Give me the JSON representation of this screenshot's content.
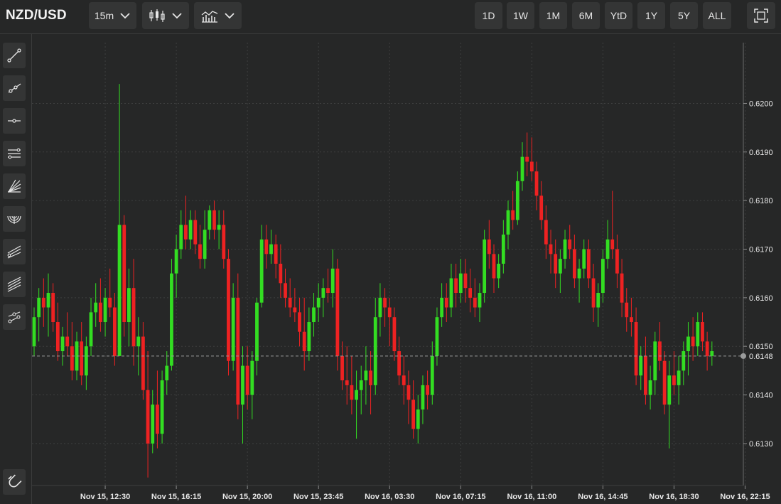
{
  "header": {
    "symbol": "NZD/USD",
    "interval": "15m",
    "chart_type_icon": "candlestick-icon",
    "indicators_icon": "indicators-icon",
    "ranges": [
      "1D",
      "1W",
      "1M",
      "6M",
      "YtD",
      "1Y",
      "5Y",
      "ALL"
    ],
    "fullscreen_icon": "fullscreen-icon"
  },
  "toolbar": {
    "tools": [
      "trend-line-icon",
      "ray-icon",
      "horizontal-line-icon",
      "parallel-channel-icon",
      "fib-fan-icon",
      "fib-arc-icon",
      "pitchfork-icon",
      "regression-channel-icon",
      "path-icon"
    ],
    "bottom_tool": "magnet-icon"
  },
  "colors": {
    "background": "#262727",
    "panel": "#343535",
    "up": "#33dd22",
    "down": "#ee2222",
    "grid": "#3e3f3f",
    "text": "#e8e8e8"
  },
  "chart_data": {
    "type": "candlestick",
    "x_tick_labels": [
      "Nov 15, 12:30",
      "Nov 15, 16:15",
      "Nov 15, 20:00",
      "Nov 15, 23:45",
      "Nov 16, 03:30",
      "Nov 16, 07:15",
      "Nov 16, 11:00",
      "Nov 16, 14:45",
      "Nov 16, 18:30",
      "Nov 16, 22:15"
    ],
    "y_ticks": [
      0.613,
      0.614,
      0.615,
      0.616,
      0.617,
      0.618,
      0.619,
      0.62
    ],
    "y_tick_labels": [
      "0.6130",
      "0.6140",
      "0.6150",
      "0.6160",
      "0.6170",
      "0.6180",
      "0.6190",
      "0.6200"
    ],
    "ylim": [
      0.61215,
      0.62125
    ],
    "bars_per_tick": 15,
    "first_tick_bar": 15,
    "last_price": 0.6148,
    "last_price_label": "0.6148",
    "grid": true,
    "ohlc": [
      [
        0.615,
        0.6158,
        0.6148,
        0.6156
      ],
      [
        0.6156,
        0.6162,
        0.6151,
        0.616
      ],
      [
        0.616,
        0.6164,
        0.6154,
        0.6158
      ],
      [
        0.6158,
        0.6165,
        0.6152,
        0.6161
      ],
      [
        0.6161,
        0.6163,
        0.6153,
        0.6155
      ],
      [
        0.6155,
        0.6159,
        0.6147,
        0.6149
      ],
      [
        0.6149,
        0.6154,
        0.6146,
        0.6152
      ],
      [
        0.6152,
        0.6157,
        0.6148,
        0.615
      ],
      [
        0.615,
        0.6155,
        0.6143,
        0.6145
      ],
      [
        0.6145,
        0.6153,
        0.6143,
        0.6151
      ],
      [
        0.6151,
        0.6155,
        0.6142,
        0.6144
      ],
      [
        0.6144,
        0.6152,
        0.6141,
        0.615
      ],
      [
        0.615,
        0.616,
        0.6148,
        0.6157
      ],
      [
        0.6157,
        0.6163,
        0.6154,
        0.6159
      ],
      [
        0.6159,
        0.6164,
        0.6153,
        0.6155
      ],
      [
        0.6155,
        0.6162,
        0.6152,
        0.616
      ],
      [
        0.616,
        0.6166,
        0.6156,
        0.6158
      ],
      [
        0.6158,
        0.6161,
        0.6146,
        0.6148
      ],
      [
        0.6148,
        0.6204,
        0.6148,
        0.6175
      ],
      [
        0.6175,
        0.6177,
        0.6152,
        0.6155
      ],
      [
        0.6155,
        0.6166,
        0.615,
        0.6162
      ],
      [
        0.6162,
        0.6168,
        0.6146,
        0.615
      ],
      [
        0.615,
        0.6156,
        0.6144,
        0.6152
      ],
      [
        0.6152,
        0.6155,
        0.6139,
        0.6141
      ],
      [
        0.6141,
        0.6149,
        0.6123,
        0.613
      ],
      [
        0.613,
        0.6141,
        0.6128,
        0.6138
      ],
      [
        0.6138,
        0.6145,
        0.6129,
        0.6132
      ],
      [
        0.6132,
        0.6145,
        0.613,
        0.6143
      ],
      [
        0.6143,
        0.6149,
        0.614,
        0.6146
      ],
      [
        0.6146,
        0.6168,
        0.6145,
        0.6165
      ],
      [
        0.6165,
        0.6173,
        0.616,
        0.617
      ],
      [
        0.617,
        0.6178,
        0.6168,
        0.6175
      ],
      [
        0.6175,
        0.6181,
        0.617,
        0.6172
      ],
      [
        0.6172,
        0.6178,
        0.617,
        0.6176
      ],
      [
        0.6176,
        0.6178,
        0.6169,
        0.6171
      ],
      [
        0.6171,
        0.6175,
        0.6166,
        0.6168
      ],
      [
        0.6168,
        0.6178,
        0.6166,
        0.6174
      ],
      [
        0.6174,
        0.6179,
        0.6172,
        0.6178
      ],
      [
        0.6178,
        0.618,
        0.6172,
        0.6174
      ],
      [
        0.6174,
        0.6178,
        0.617,
        0.6175
      ],
      [
        0.6175,
        0.6178,
        0.6166,
        0.6168
      ],
      [
        0.6168,
        0.617,
        0.6144,
        0.6147
      ],
      [
        0.6147,
        0.6163,
        0.6145,
        0.616
      ],
      [
        0.616,
        0.6165,
        0.6135,
        0.6138
      ],
      [
        0.6138,
        0.615,
        0.613,
        0.6146
      ],
      [
        0.6146,
        0.615,
        0.6137,
        0.614
      ],
      [
        0.614,
        0.6149,
        0.6135,
        0.6147
      ],
      [
        0.6147,
        0.616,
        0.6144,
        0.6159
      ],
      [
        0.6159,
        0.6175,
        0.6158,
        0.6172
      ],
      [
        0.6172,
        0.6175,
        0.6166,
        0.6169
      ],
      [
        0.6169,
        0.6174,
        0.6167,
        0.6171
      ],
      [
        0.6171,
        0.6173,
        0.6164,
        0.6167
      ],
      [
        0.6167,
        0.6171,
        0.616,
        0.6163
      ],
      [
        0.6163,
        0.6166,
        0.6158,
        0.616
      ],
      [
        0.616,
        0.6164,
        0.6156,
        0.6158
      ],
      [
        0.6158,
        0.6162,
        0.6155,
        0.6157
      ],
      [
        0.6157,
        0.616,
        0.615,
        0.6153
      ],
      [
        0.6153,
        0.616,
        0.6145,
        0.6149
      ],
      [
        0.6149,
        0.6158,
        0.6147,
        0.6155
      ],
      [
        0.6155,
        0.6161,
        0.6152,
        0.6158
      ],
      [
        0.6158,
        0.6163,
        0.6155,
        0.616
      ],
      [
        0.616,
        0.6164,
        0.6156,
        0.6162
      ],
      [
        0.6162,
        0.6166,
        0.6159,
        0.6161
      ],
      [
        0.6161,
        0.617,
        0.6158,
        0.6166
      ],
      [
        0.6166,
        0.6168,
        0.6145,
        0.6148
      ],
      [
        0.6148,
        0.6151,
        0.6141,
        0.6143
      ],
      [
        0.6143,
        0.615,
        0.6138,
        0.6142
      ],
      [
        0.6142,
        0.6148,
        0.6136,
        0.6139
      ],
      [
        0.6139,
        0.6145,
        0.6131,
        0.6141
      ],
      [
        0.6141,
        0.6146,
        0.6136,
        0.6143
      ],
      [
        0.6143,
        0.615,
        0.6138,
        0.6145
      ],
      [
        0.6145,
        0.6149,
        0.6136,
        0.6142
      ],
      [
        0.6142,
        0.616,
        0.614,
        0.6156
      ],
      [
        0.6156,
        0.6163,
        0.6152,
        0.616
      ],
      [
        0.616,
        0.6162,
        0.6154,
        0.6158
      ],
      [
        0.6158,
        0.616,
        0.615,
        0.6156
      ],
      [
        0.6156,
        0.6158,
        0.6147,
        0.6149
      ],
      [
        0.6149,
        0.6152,
        0.6142,
        0.6144
      ],
      [
        0.6144,
        0.6148,
        0.6138,
        0.6142
      ],
      [
        0.6142,
        0.6145,
        0.6134,
        0.6139
      ],
      [
        0.6139,
        0.6143,
        0.6131,
        0.6133
      ],
      [
        0.6133,
        0.614,
        0.613,
        0.6137
      ],
      [
        0.6137,
        0.6144,
        0.6134,
        0.6142
      ],
      [
        0.6142,
        0.6145,
        0.6137,
        0.614
      ],
      [
        0.614,
        0.6151,
        0.6138,
        0.6148
      ],
      [
        0.6148,
        0.6158,
        0.6146,
        0.6156
      ],
      [
        0.6156,
        0.6163,
        0.6154,
        0.616
      ],
      [
        0.616,
        0.6163,
        0.6155,
        0.6158
      ],
      [
        0.6158,
        0.6167,
        0.6156,
        0.6164
      ],
      [
        0.6164,
        0.6167,
        0.6158,
        0.6161
      ],
      [
        0.6161,
        0.6168,
        0.6159,
        0.6165
      ],
      [
        0.6165,
        0.6168,
        0.6159,
        0.6162
      ],
      [
        0.6162,
        0.6166,
        0.6157,
        0.616
      ],
      [
        0.616,
        0.6164,
        0.6156,
        0.6158
      ],
      [
        0.6158,
        0.6163,
        0.6155,
        0.6161
      ],
      [
        0.6161,
        0.6174,
        0.6159,
        0.6172
      ],
      [
        0.6172,
        0.6176,
        0.6166,
        0.6169
      ],
      [
        0.6169,
        0.6171,
        0.6161,
        0.6164
      ],
      [
        0.6164,
        0.6169,
        0.6162,
        0.6167
      ],
      [
        0.6167,
        0.6176,
        0.6165,
        0.6173
      ],
      [
        0.6173,
        0.618,
        0.617,
        0.6178
      ],
      [
        0.6178,
        0.6182,
        0.6174,
        0.6176
      ],
      [
        0.6176,
        0.6186,
        0.6175,
        0.6184
      ],
      [
        0.6184,
        0.6192,
        0.6182,
        0.6189
      ],
      [
        0.6189,
        0.6194,
        0.6185,
        0.6188
      ],
      [
        0.6188,
        0.6193,
        0.6184,
        0.6186
      ],
      [
        0.6186,
        0.6188,
        0.6178,
        0.6181
      ],
      [
        0.6181,
        0.6184,
        0.6174,
        0.6176
      ],
      [
        0.6176,
        0.6179,
        0.6168,
        0.6171
      ],
      [
        0.6171,
        0.6174,
        0.6165,
        0.6169
      ],
      [
        0.6169,
        0.6172,
        0.6162,
        0.6165
      ],
      [
        0.6165,
        0.617,
        0.6161,
        0.6168
      ],
      [
        0.6168,
        0.6174,
        0.6166,
        0.6172
      ],
      [
        0.6172,
        0.6175,
        0.6168,
        0.617
      ],
      [
        0.617,
        0.6173,
        0.6162,
        0.6164
      ],
      [
        0.6164,
        0.6168,
        0.6159,
        0.6166
      ],
      [
        0.6166,
        0.6172,
        0.6164,
        0.617
      ],
      [
        0.617,
        0.6172,
        0.6162,
        0.6164
      ],
      [
        0.6164,
        0.6167,
        0.6155,
        0.6158
      ],
      [
        0.6158,
        0.6163,
        0.6154,
        0.6161
      ],
      [
        0.6161,
        0.617,
        0.6159,
        0.6168
      ],
      [
        0.6168,
        0.6176,
        0.6166,
        0.6172
      ],
      [
        0.6172,
        0.6182,
        0.6168,
        0.617
      ],
      [
        0.617,
        0.6173,
        0.6162,
        0.6165
      ],
      [
        0.6165,
        0.6168,
        0.6156,
        0.6159
      ],
      [
        0.6159,
        0.6162,
        0.6153,
        0.6156
      ],
      [
        0.6156,
        0.616,
        0.6152,
        0.6155
      ],
      [
        0.6155,
        0.6158,
        0.6142,
        0.6144
      ],
      [
        0.6144,
        0.615,
        0.6141,
        0.6148
      ],
      [
        0.6148,
        0.6152,
        0.6138,
        0.614
      ],
      [
        0.614,
        0.6146,
        0.6137,
        0.6143
      ],
      [
        0.6143,
        0.6153,
        0.614,
        0.6151
      ],
      [
        0.6151,
        0.6155,
        0.6145,
        0.6147
      ],
      [
        0.6147,
        0.6149,
        0.6136,
        0.6138
      ],
      [
        0.6138,
        0.6147,
        0.6129,
        0.6144
      ],
      [
        0.6144,
        0.6149,
        0.614,
        0.6142
      ],
      [
        0.6142,
        0.6148,
        0.6138,
        0.6145
      ],
      [
        0.6145,
        0.6151,
        0.6142,
        0.6149
      ],
      [
        0.6149,
        0.6155,
        0.6144,
        0.6152
      ],
      [
        0.6152,
        0.6156,
        0.6147,
        0.615
      ],
      [
        0.615,
        0.6157,
        0.6148,
        0.6155
      ],
      [
        0.6155,
        0.6157,
        0.6149,
        0.6151
      ],
      [
        0.6151,
        0.6153,
        0.6145,
        0.6148
      ],
      [
        0.6148,
        0.6151,
        0.6146,
        0.6149
      ]
    ]
  }
}
